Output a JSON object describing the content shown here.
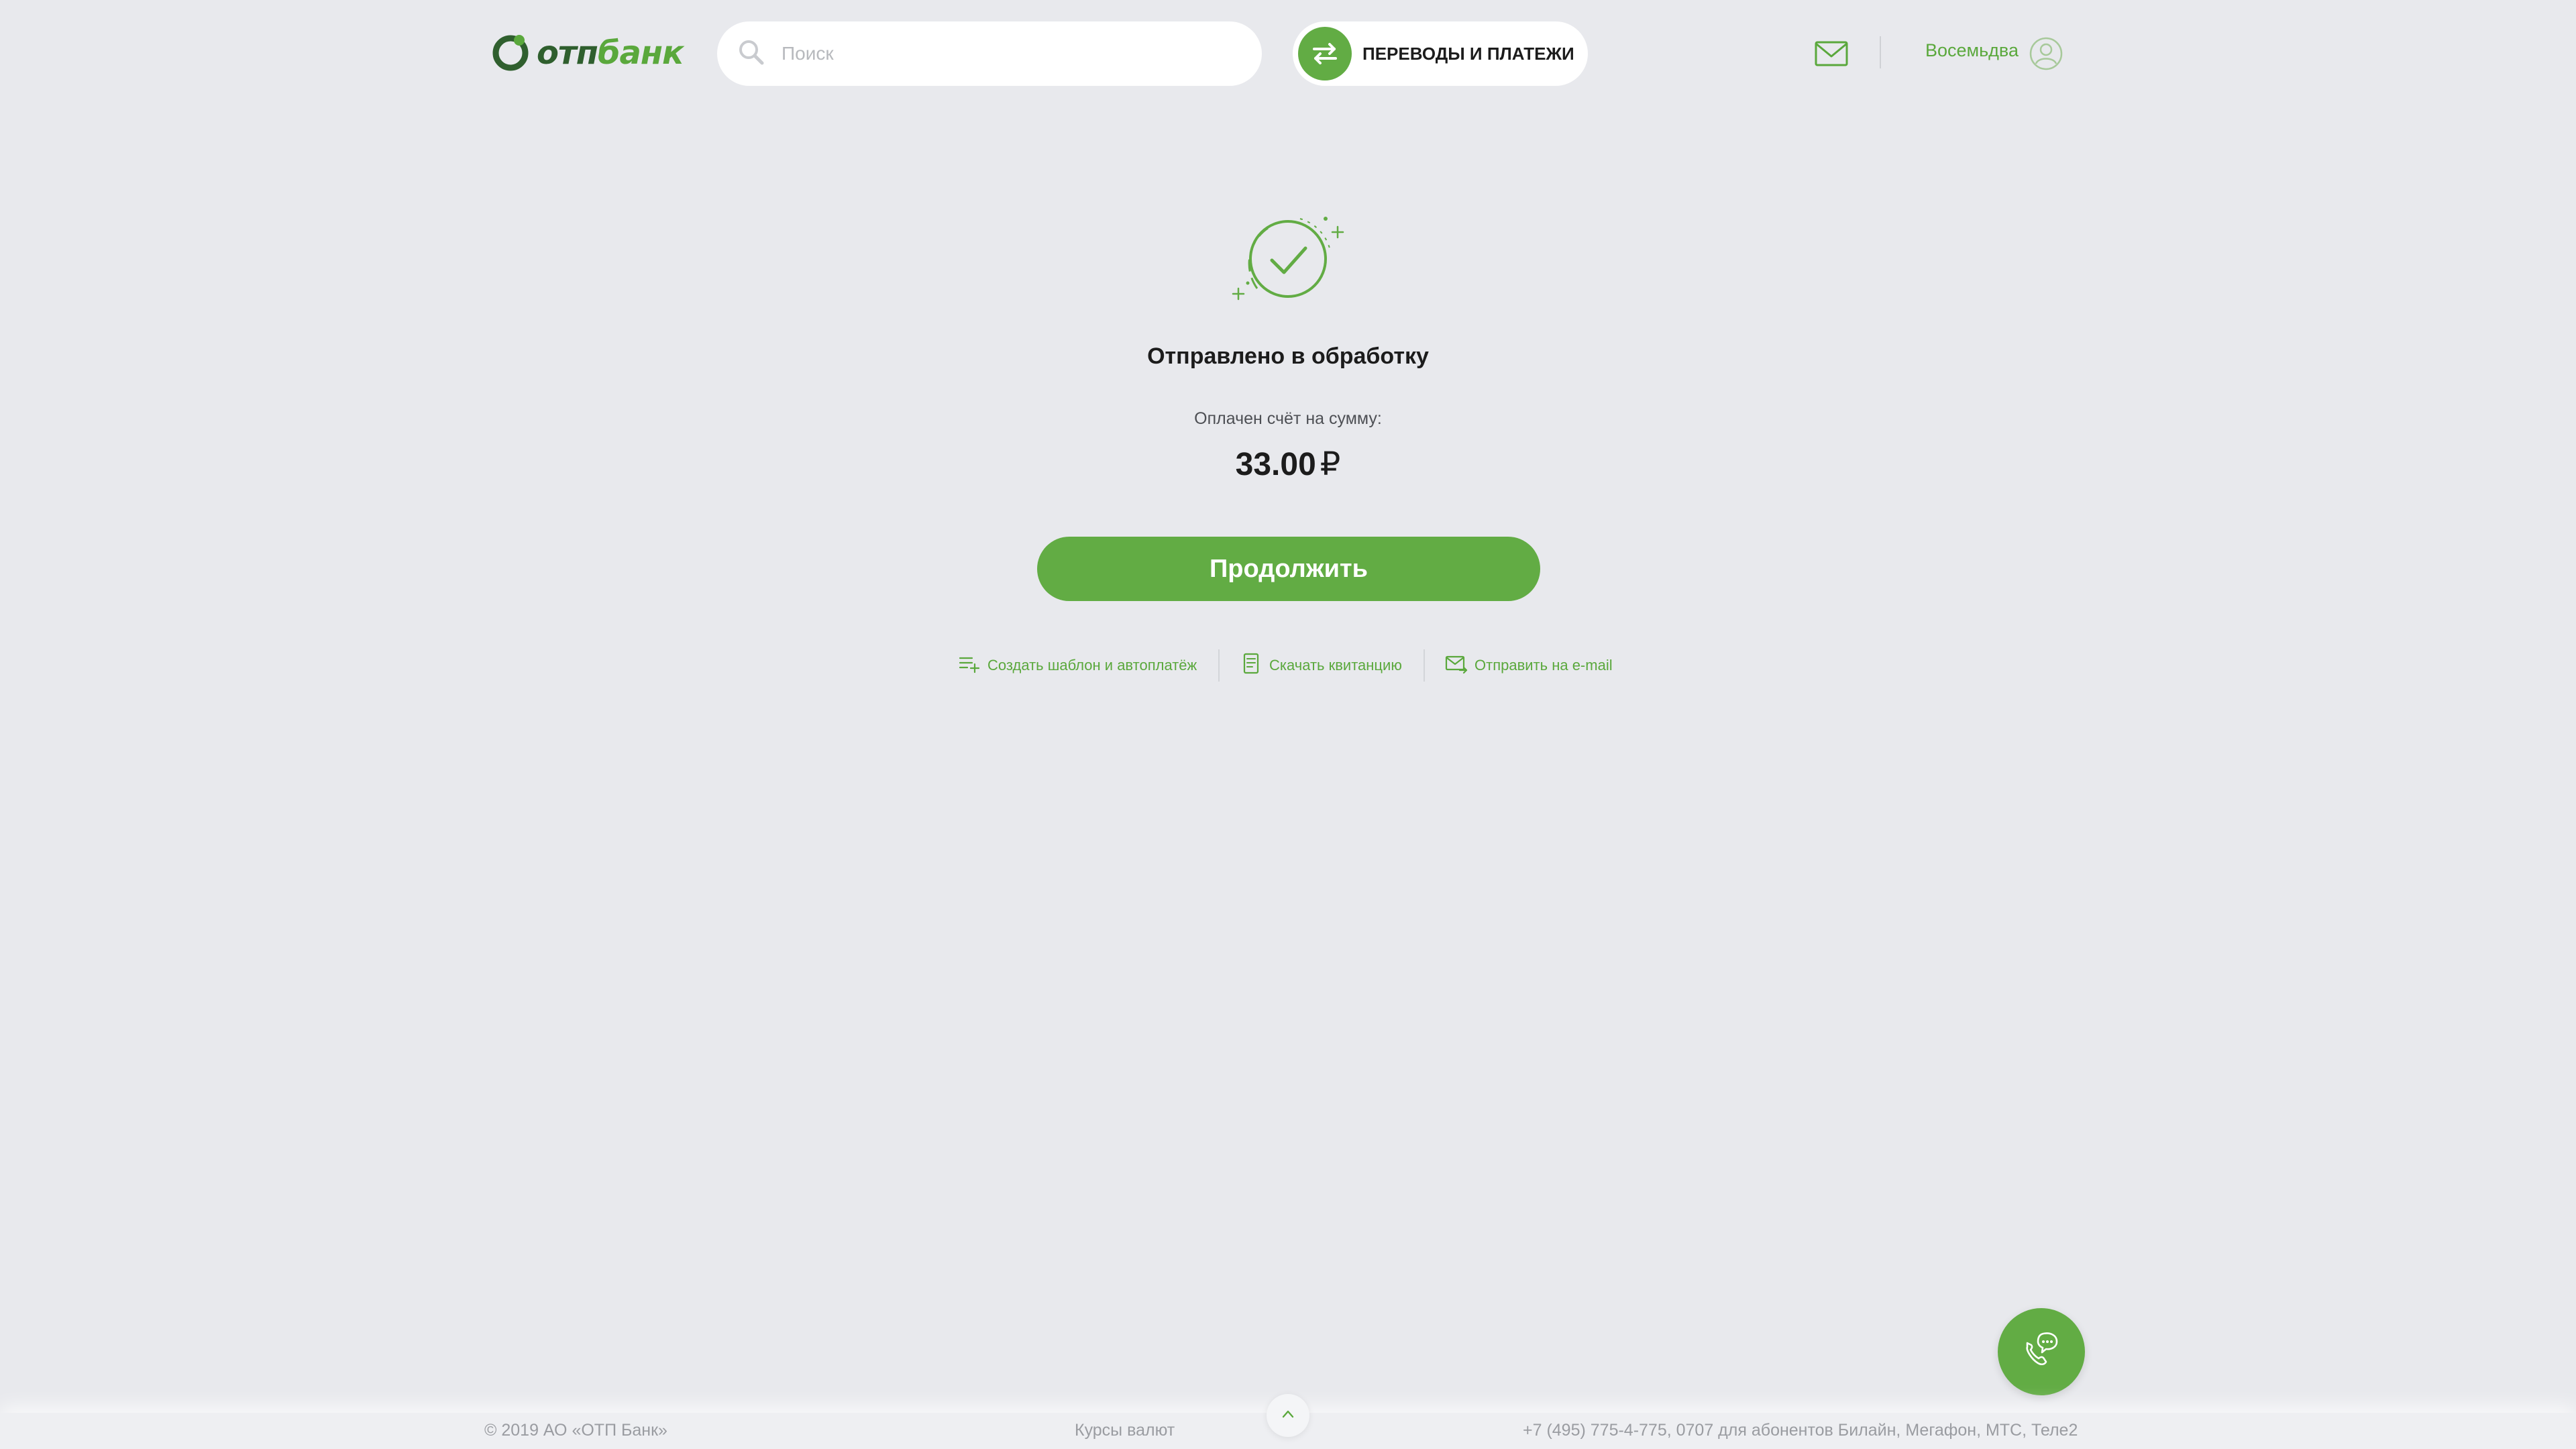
{
  "colors": {
    "accent": "#62ac44",
    "link": "#5aa83c",
    "brand_dark": "#2f5f2e",
    "background": "#e8e9ed"
  },
  "header": {
    "logo": {
      "text_otp": "отп",
      "text_bank": "банк",
      "icon": "otp-logo-icon"
    },
    "search": {
      "placeholder": "Поиск",
      "value": "",
      "icon": "search-icon"
    },
    "transfers_button": {
      "label": "ПЕРЕВОДЫ И ПЛАТЕЖИ",
      "icon": "transfer-arrows-icon"
    },
    "mail_icon": "mail-icon",
    "user": {
      "name": "Восемьдва",
      "icon": "user-avatar-icon"
    }
  },
  "main": {
    "status_icon": "success-check-icon",
    "title": "Отправлено в обработку",
    "subtitle": "Оплачен счёт на сумму:",
    "amount": "33.00",
    "currency": "₽",
    "continue_label": "Продолжить",
    "actions": [
      {
        "label": "Создать шаблон и автоплатёж",
        "icon": "template-list-icon"
      },
      {
        "label": "Скачать квитанцию",
        "icon": "receipt-icon"
      },
      {
        "label": "Отправить на e-mail",
        "icon": "send-email-icon"
      }
    ]
  },
  "chat_button": {
    "icon": "phone-chat-icon"
  },
  "scroll_top": {
    "icon": "chevron-up-icon"
  },
  "footer": {
    "copyright": "© 2019 АО «ОТП Банк»",
    "rates_link": "Курсы валют",
    "phone": "+7 (495) 775-4-775,  0707 для абонентов Билайн, Мегафон, МТС, Теле2"
  }
}
